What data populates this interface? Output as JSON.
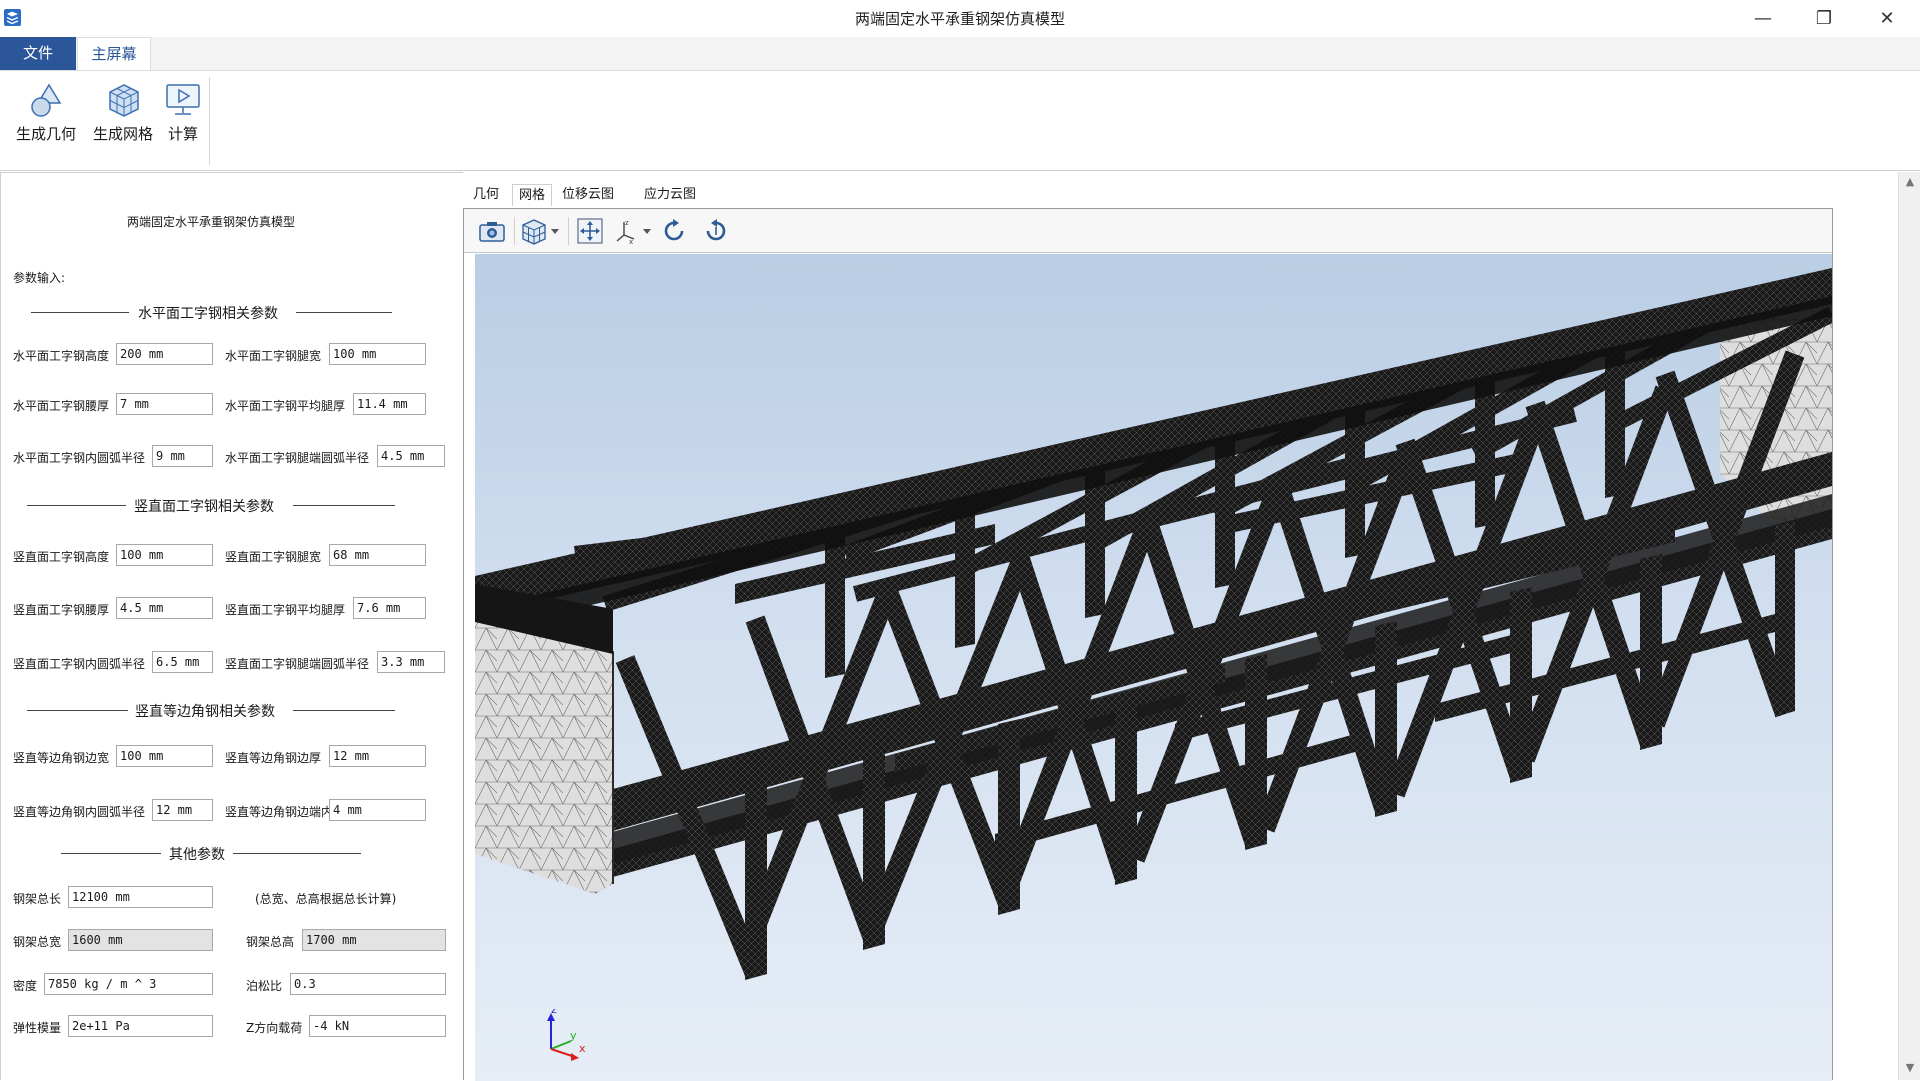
{
  "window": {
    "title": "两端固定水平承重钢架仿真模型",
    "minimize": "—",
    "restore": "❐",
    "close": "✕"
  },
  "ribbon": {
    "tabs": [
      {
        "label": "文件"
      },
      {
        "label": "主屏幕"
      }
    ],
    "buttons": {
      "geometry": "生成几何",
      "mesh": "生成网格",
      "compute": "计算"
    }
  },
  "panel": {
    "title": "两端固定水平承重钢架仿真模型",
    "input_label": "参数输入:",
    "horizontal": {
      "header": "水平面工字钢相关参数",
      "height_label": "水平面工字钢高度",
      "height": "200 mm",
      "leg_width_label": "水平面工字钢腿宽",
      "leg_width": "100 mm",
      "web_label": "水平面工字钢腰厚",
      "web": "7 mm",
      "avg_leg_label": "水平面工字钢平均腿厚",
      "avg_leg": "11.4 mm",
      "inner_r_label": "水平面工字钢内圆弧半径",
      "inner_r": "9 mm",
      "end_r_label": "水平面工字钢腿端圆弧半径",
      "end_r": "4.5 mm"
    },
    "vertical": {
      "header": "竖直面工字钢相关参数",
      "height_label": "竖直面工字钢高度",
      "height": "100 mm",
      "leg_width_label": "竖直面工字钢腿宽",
      "leg_width": "68 mm",
      "web_label": "竖直面工字钢腰厚",
      "web": "4.5 mm",
      "avg_leg_label": "竖直面工字钢平均腿厚",
      "avg_leg": "7.6 mm",
      "inner_r_label": "竖直面工字钢内圆弧半径",
      "inner_r": "6.5 mm",
      "end_r_label": "竖直面工字钢腿端圆弧半径",
      "end_r": "3.3 mm"
    },
    "angle": {
      "header": "竖直等边角钢相关参数",
      "side_label": "竖直等边角钢边宽",
      "side": "100 mm",
      "thick_label": "竖直等边角钢边厚",
      "thick": "12 mm",
      "inner_r_label": "竖直等边角钢内圆弧半径",
      "inner_r": "12 mm",
      "end_r_label": "竖直等边角钢边端内弧半径",
      "end_r": "4 mm"
    },
    "other": {
      "header": "其他参数",
      "length_label": "钢架总长",
      "length": "12100 mm",
      "note": "(总宽、总高根据总长计算)",
      "width_label": "钢架总宽",
      "width": "1600 mm",
      "total_height_label": "钢架总高",
      "total_height": "1700 mm",
      "density_label": "密度",
      "density": "7850 kg / m ^ 3",
      "poisson_label": "泊松比",
      "poisson": "0.3",
      "modulus_label": "弹性模量",
      "modulus": "2e+11 Pa",
      "load_label": "Z方向载荷",
      "load": "-4 kN"
    }
  },
  "view_tabs": [
    {
      "label": "几何"
    },
    {
      "label": "网格"
    },
    {
      "label": "位移云图"
    },
    {
      "label": "应力云图"
    }
  ],
  "axes": {
    "x": "x",
    "y": "y",
    "z": "z"
  },
  "colors": {
    "accent": "#2b579a",
    "mesh": "#151515",
    "end_face": "#dedede",
    "sky_top": "#b9cde4"
  }
}
